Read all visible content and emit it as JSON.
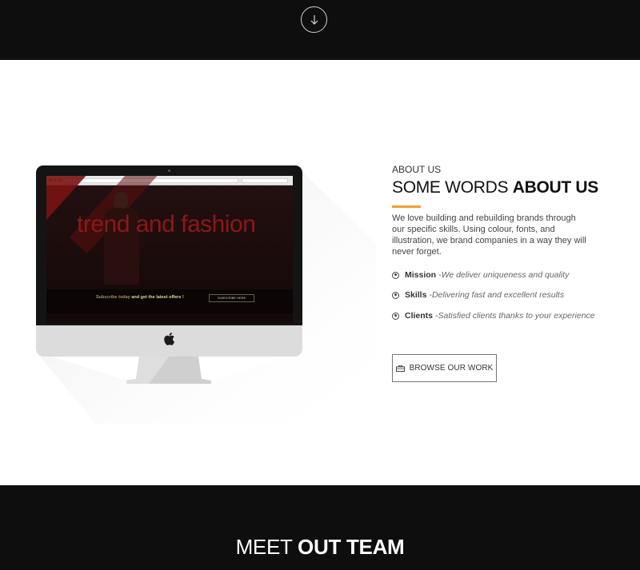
{
  "top": {
    "scroll_icon": "arrow-down-icon"
  },
  "about": {
    "eyebrow": "ABOUT US",
    "heading_light": "SOME WORDS ",
    "heading_bold": "ABOUT US",
    "intro": "We love building and rebuilding brands through our specific skills. Using colour, fonts, and illustration, we brand companies in a way they will never forget.",
    "accent_color": "#f0a030",
    "bullets": [
      {
        "term": "Mission",
        "separator": " - ",
        "desc": "We deliver uniqueness and quality"
      },
      {
        "term": "Skills",
        "separator": " - ",
        "desc": "Delivering fast and excellent results"
      },
      {
        "term": "Clients",
        "separator": " - ",
        "desc": "Satisfied clients thanks to your experience"
      }
    ],
    "button_label": "BROWSE OUR WORK",
    "button_icon": "briefcase-icon"
  },
  "imac": {
    "hero_title": "trend and fashion",
    "subscribe_a": "Subscribe today ",
    "subscribe_b": "and get the latest offers !",
    "subscribe_btn": "SUBSCRIBE HERE"
  },
  "team": {
    "title_light": "MEET ",
    "title_bold": "OUT TEAM"
  }
}
